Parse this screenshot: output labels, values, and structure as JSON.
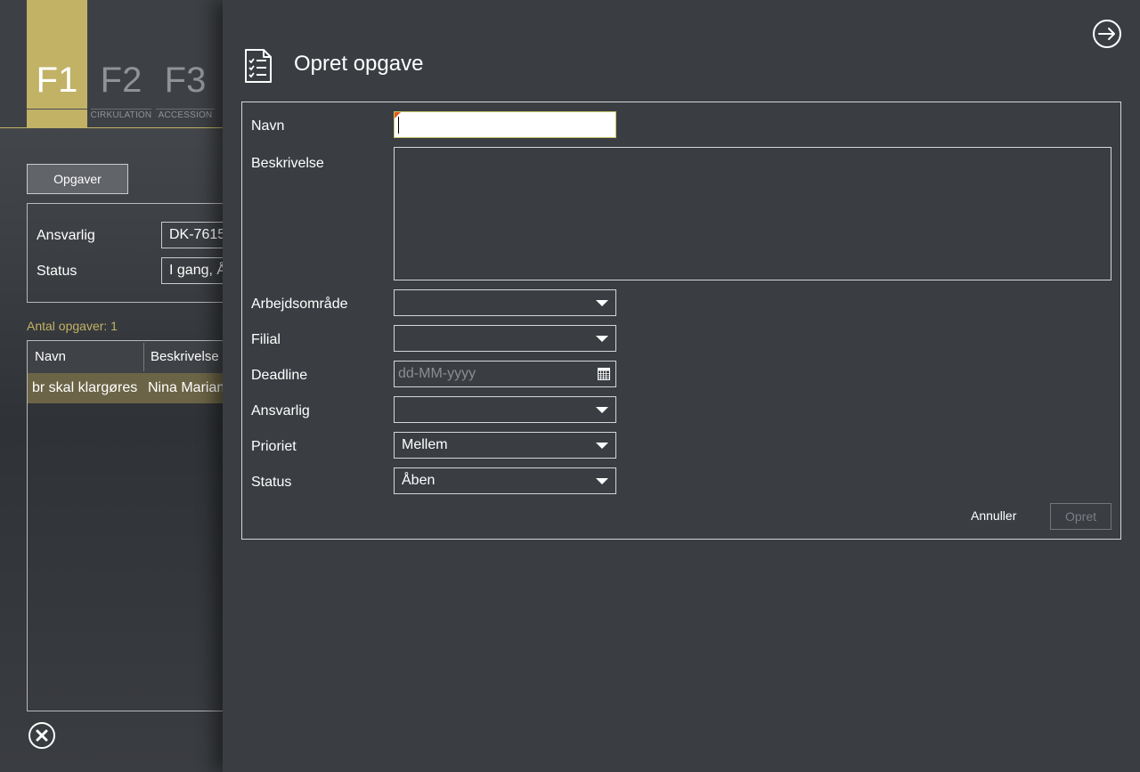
{
  "background": {
    "fkeys": [
      {
        "key": "F1",
        "label": ""
      },
      {
        "key": "F2",
        "label": "CIRKULATION"
      },
      {
        "key": "F3",
        "label": "ACCESSION"
      }
    ],
    "tasks_button": "Opgaver",
    "filter": {
      "responsible_label": "Ansvarlig",
      "responsible_value": "DK-7615",
      "status_label": "Status",
      "status_value": "I gang, Å"
    },
    "count_label": "Antal opgaver: 1",
    "table": {
      "columns": [
        "Navn",
        "Beskrivelse"
      ],
      "rows": [
        [
          "br skal klargøres",
          "Nina Marian"
        ]
      ]
    }
  },
  "dialog": {
    "title": "Opret opgave",
    "fields": {
      "name_label": "Navn",
      "name_value": "",
      "description_label": "Beskrivelse",
      "description_value": "",
      "workarea_label": "Arbejdsområde",
      "workarea_value": "",
      "branch_label": "Filial",
      "branch_value": "",
      "deadline_label": "Deadline",
      "deadline_placeholder": "dd-MM-yyyy",
      "responsible_label": "Ansvarlig",
      "responsible_value": "",
      "priority_label": "Prioriet",
      "priority_value": "Mellem",
      "status_label": "Status",
      "status_value": "Åben"
    },
    "cancel_label": "Annuller",
    "create_label": "Opret"
  },
  "colors": {
    "accent": "#c2b266",
    "panel_bg": "#3a3e43",
    "selected_row": "#6b6446",
    "required_flag": "#e05a1a"
  },
  "icons": {
    "exit": "arrow-right-circle-icon",
    "dialog": "checklist-icon",
    "close": "close-circle-icon",
    "calendar": "calendar-icon",
    "dropdown": "chevron-down-icon"
  }
}
